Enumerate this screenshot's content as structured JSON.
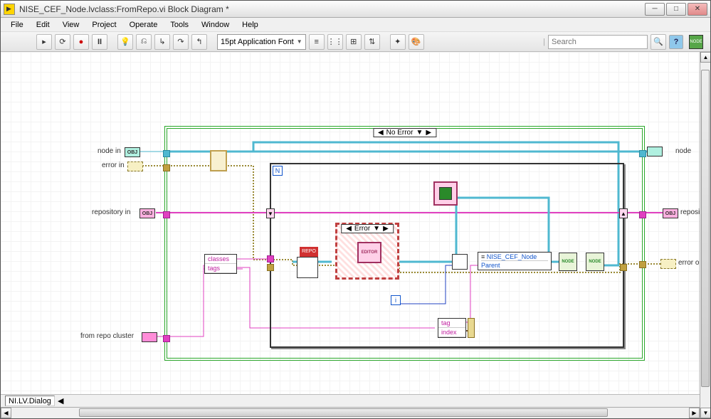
{
  "window": {
    "title": "NISE_CEF_Node.lvclass:FromRepo.vi Block Diagram *"
  },
  "menu": {
    "file": "File",
    "edit": "Edit",
    "view": "View",
    "project": "Project",
    "operate": "Operate",
    "tools": "Tools",
    "window": "Window",
    "help": "Help"
  },
  "toolbar": {
    "font": "15pt Application Font",
    "search_placeholder": "Search",
    "search_value": "",
    "node_icon": "NODE"
  },
  "diagram": {
    "terminals": {
      "node_in": "node in",
      "error_in": "error in",
      "repository_in": "repository in",
      "from_repo_cluster": "from repo cluster",
      "node_out": "node",
      "repository_out": "repositor",
      "error_out": "error out"
    },
    "obj_text": "OBJ",
    "outer_case": "No Error",
    "inner_case": "Error",
    "for_n": "N",
    "for_i": "i",
    "unbundle1": {
      "classes": "classes",
      "tags": "tags"
    },
    "unbundle2": {
      "tag": "tag",
      "index": "index"
    },
    "class_ref": "NISE_CEF_Node",
    "class_prop": "Parent",
    "editor": "EDITOR",
    "repo": "REPO",
    "node_badge": "NODE"
  },
  "status": {
    "context": "NI.LV.Dialog"
  },
  "colors": {
    "accent_teal": "#4fb8d0",
    "accent_pink": "#e040c0",
    "accent_gold": "#9a8a35",
    "struct_green": "#2aa82a"
  }
}
